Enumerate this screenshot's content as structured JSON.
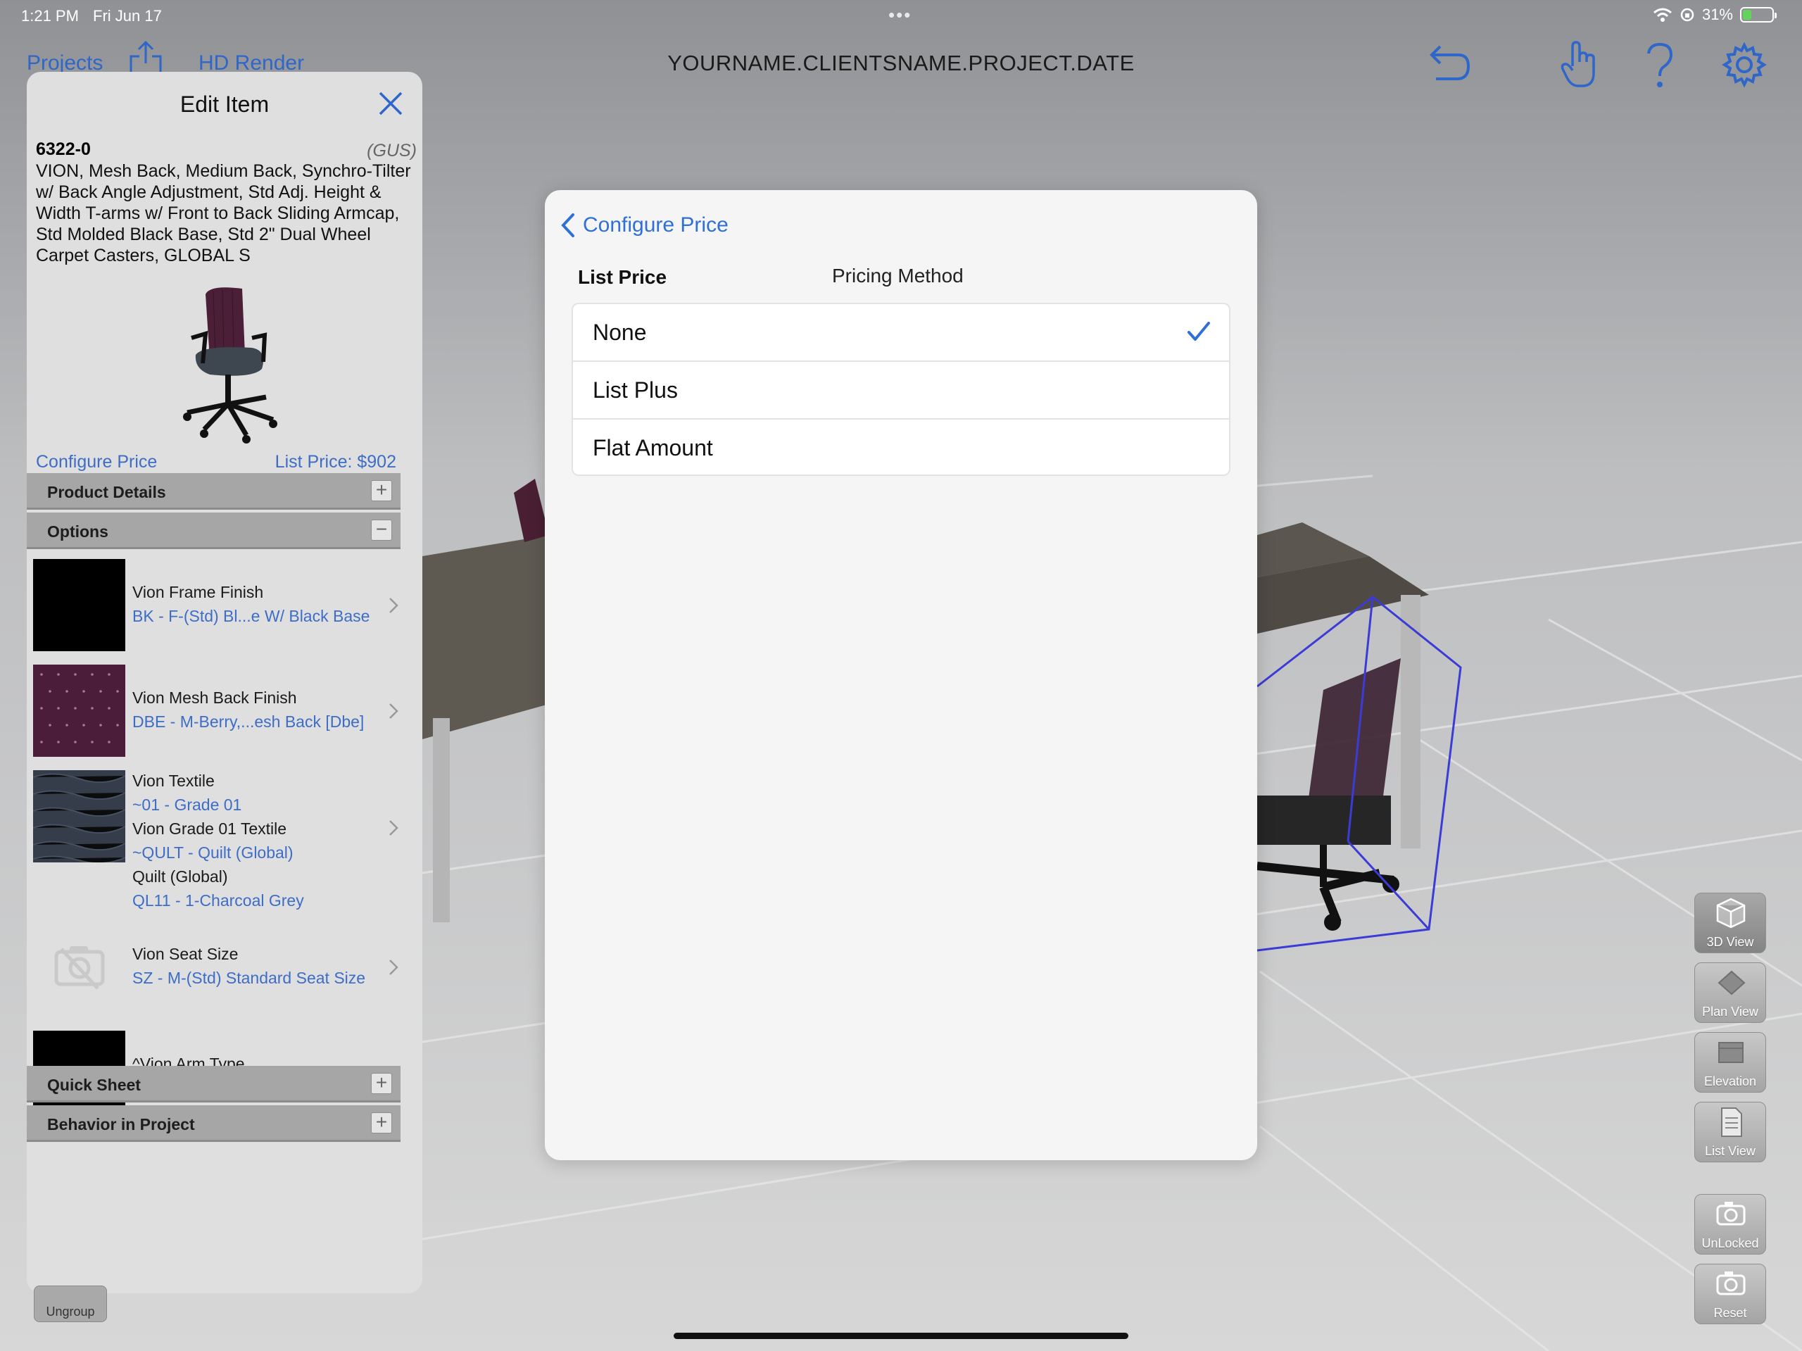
{
  "status": {
    "time": "1:21 PM",
    "date": "Fri Jun 17",
    "battery": "31%",
    "battery_level": 0.31
  },
  "toolbar": {
    "projects_label": "Projects",
    "hd_render_label": "HD Render",
    "project_title": "YOURNAME.CLIENTSNAME.PROJECT.DATE",
    "icons": [
      "share-icon",
      "undo-icon",
      "hand-pointer-icon",
      "help-icon",
      "gear-icon"
    ]
  },
  "edit_panel": {
    "title": "Edit Item",
    "item_code": "6322-0",
    "brand": "(GUS)",
    "description": "VION, Mesh Back, Medium Back, Synchro-Tilter w/ Back Angle Adjustment, Std Adj. Height & Width T-arms w/ Front to Back Sliding Armcap, Std Molded Black Base, Std 2\" Dual Wheel Carpet Casters, GLOBAL S",
    "configure_price_label": "Configure Price",
    "list_price_label": "List Price: $902",
    "sections": {
      "product_details": "Product Details",
      "options": "Options",
      "quick_sheet": "Quick Sheet",
      "behavior": "Behavior in Project"
    },
    "options": [
      {
        "title": "Vion Frame Finish",
        "value": "BK - F-(Std) Bl...e W/ Black Base",
        "swatch": "#000000"
      },
      {
        "title": "Vion Mesh Back Finish",
        "value": "DBE - M-Berry,...esh Back [Dbe]",
        "swatch": "#4b1d3a"
      },
      {
        "title": "Vion Textile",
        "value": "~01 - Grade 01",
        "title2": "Vion Grade 01 Textile",
        "value2": "~QULT - Quilt (Global)",
        "title3": "Quilt (Global)",
        "value3": "QL11 - 1-Charcoal Grey",
        "swatch": "#3a4150"
      },
      {
        "title": "Vion Seat Size",
        "value": "SZ - M-(Std) Standard Seat Size",
        "swatch": "none"
      },
      {
        "title": "^Vion Arm Type",
        "swatch": "#000000"
      }
    ],
    "ungroup_label": "Ungroup"
  },
  "popover": {
    "back_label": "Configure Price",
    "col_list_price": "List Price",
    "col_pricing_method": "Pricing Method",
    "methods": [
      {
        "label": "None",
        "selected": true
      },
      {
        "label": "List Plus",
        "selected": false
      },
      {
        "label": "Flat Amount",
        "selected": false
      }
    ]
  },
  "view_buttons": {
    "view_3d": "3D View",
    "plan": "Plan View",
    "elevation": "Elevation",
    "list": "List View",
    "unlocked": "UnLocked",
    "reset": "Reset"
  },
  "colors": {
    "accent": "#2f6fd7",
    "link": "#3d6dc7",
    "panel_bg": "#dfdfdf",
    "section_bar": "#a6a6a6"
  }
}
